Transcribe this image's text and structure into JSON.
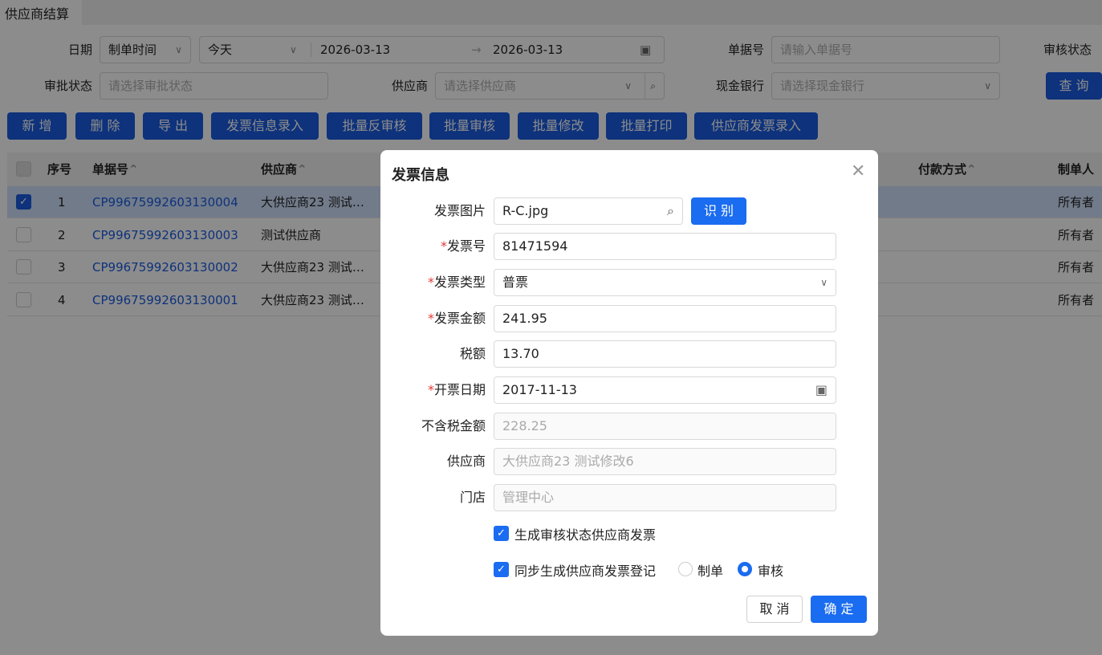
{
  "tab": {
    "title": "供应商结算"
  },
  "filters": {
    "date_label": "日期",
    "date_type": "制单时间",
    "date_range_preset": "今天",
    "date_start": "2026-03-13",
    "date_arrow": "→",
    "date_end": "2026-03-13",
    "doc_no_label": "单据号",
    "doc_no_placeholder": "请输入单据号",
    "audit_status_label": "审核状态",
    "approval_label": "审批状态",
    "approval_placeholder": "请选择审批状态",
    "supplier_label": "供应商",
    "supplier_placeholder": "请选择供应商",
    "bank_label": "现金银行",
    "bank_placeholder": "请选择现金银行",
    "query_button": "查 询"
  },
  "toolbar": [
    "新 增",
    "删 除",
    "导 出",
    "发票信息录入",
    "批量反审核",
    "批量审核",
    "批量修改",
    "批量打印",
    "供应商发票录入"
  ],
  "table": {
    "headers": {
      "index": "序号",
      "doc_no": "单据号",
      "supplier": "供应商",
      "payment": "付款方式",
      "creator": "制单人"
    },
    "rows": [
      {
        "index": "1",
        "doc_no": "CP99675992603130004",
        "supplier": "大供应商23 测试…",
        "creator": "所有者",
        "checked": true
      },
      {
        "index": "2",
        "doc_no": "CP99675992603130003",
        "supplier": "测试供应商",
        "creator": "所有者",
        "checked": false
      },
      {
        "index": "3",
        "doc_no": "CP99675992603130002",
        "supplier": "大供应商23 测试…",
        "creator": "所有者",
        "checked": false
      },
      {
        "index": "4",
        "doc_no": "CP99675992603130001",
        "supplier": "大供应商23 测试…",
        "creator": "所有者",
        "checked": false
      }
    ]
  },
  "modal": {
    "title": "发票信息",
    "image_label": "发票图片",
    "image_value": "R-C.jpg",
    "recognize_button": "识 别",
    "invoice_no_label": "发票号",
    "invoice_no": "81471594",
    "type_label": "发票类型",
    "type_value": "普票",
    "amount_label": "发票金额",
    "amount": "241.95",
    "tax_label": "税额",
    "tax": "13.70",
    "date_label": "开票日期",
    "date": "2017-11-13",
    "net_label": "不含税金额",
    "net": "228.25",
    "supplier_label": "供应商",
    "supplier": "大供应商23 测试修改6",
    "store_label": "门店",
    "store": "管理中心",
    "check1": "生成审核状态供应商发票",
    "check2": "同步生成供应商发票登记",
    "radio1": "制单",
    "radio2": "审核",
    "cancel": "取 消",
    "ok": "确 定"
  }
}
